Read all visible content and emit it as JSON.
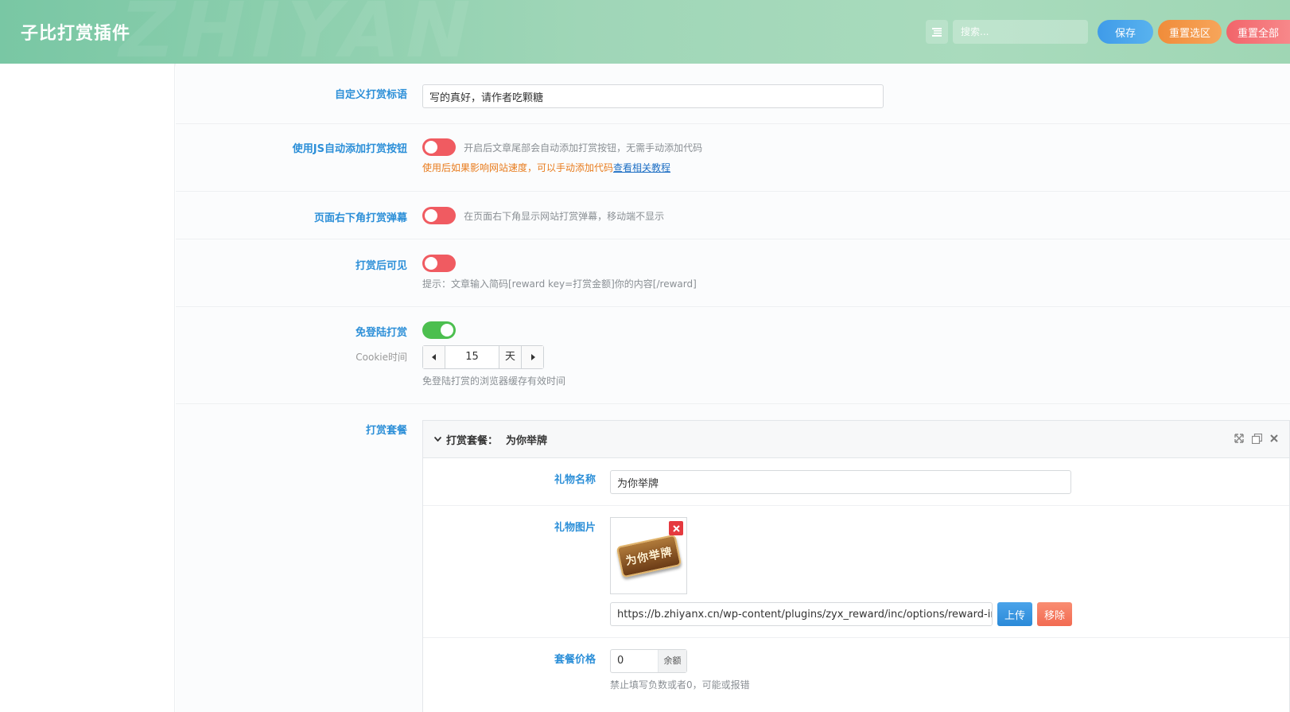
{
  "header": {
    "title": "子比打赏插件",
    "watermark": "ZHIYAN",
    "search_placeholder": "搜索...",
    "save_label": "保存",
    "reset_section_label": "重置选区",
    "reset_all_label": "重置全部"
  },
  "fields": {
    "slogan": {
      "label": "自定义打赏标语",
      "value": "写的真好，请作者吃颗糖"
    },
    "js_auto": {
      "label": "使用JS自动添加打赏按钮",
      "enabled": false,
      "desc": "开启后文章尾部会自动添加打赏按钮，无需手动添加代码",
      "warn": "使用后如果影响网站速度，可以手动添加代码",
      "link": "查看相关教程"
    },
    "danmaku": {
      "label": "页面右下角打赏弹幕",
      "enabled": false,
      "desc": "在页面右下角显示网站打赏弹幕，移动端不显示"
    },
    "reward_visible": {
      "label": "打赏后可见",
      "enabled": false,
      "hint": "提示：文章输入简码[reward key=打赏金额]你的内容[/reward]"
    },
    "no_login": {
      "label": "免登陆打赏",
      "enabled": true,
      "cookie_label": "Cookie时间",
      "cookie_value": "15",
      "cookie_unit": "天",
      "cookie_desc": "免登陆打赏的浏览器缓存有效时间"
    },
    "packages": {
      "label": "打赏套餐",
      "group_title": "打赏套餐：",
      "group_name": "为你举牌",
      "gift_name_label": "礼物名称",
      "gift_name_value": "为你举牌",
      "gift_image_label": "礼物图片",
      "gift_image_text": "为你举牌",
      "gift_image_url": "https://b.zhiyanx.cn/wp-content/plugins/zyx_reward/inc/options/reward-img/",
      "upload_label": "上传",
      "remove_label": "移除",
      "price_label": "套餐价格",
      "price_value": "0",
      "price_unit": "余额",
      "price_desc": "禁止填写负数或者0，可能或报错"
    }
  },
  "colors": {
    "accent_label": "#2c8fd8",
    "toggle_off": "#f05b61",
    "toggle_on": "#4cbf4f",
    "warn": "#e87c1e"
  }
}
